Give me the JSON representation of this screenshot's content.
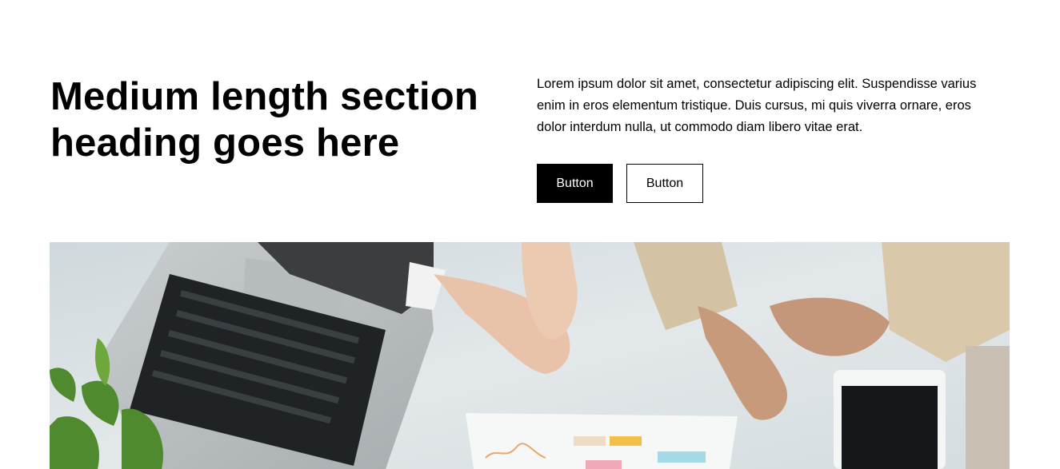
{
  "section": {
    "heading": "Medium length section heading goes here",
    "body": "Lorem ipsum dolor sit amet, consectetur adipiscing elit. Suspendisse varius enim in eros elementum tristique. Duis cursus, mi quis viverra ornare, eros dolor interdum nulla, ut commodo diam libero vitae erat.",
    "primary_button": "Button",
    "secondary_button": "Button"
  },
  "colors": {
    "primary_bg": "#000000",
    "secondary_border": "#000000",
    "page_bg": "#ffffff"
  }
}
